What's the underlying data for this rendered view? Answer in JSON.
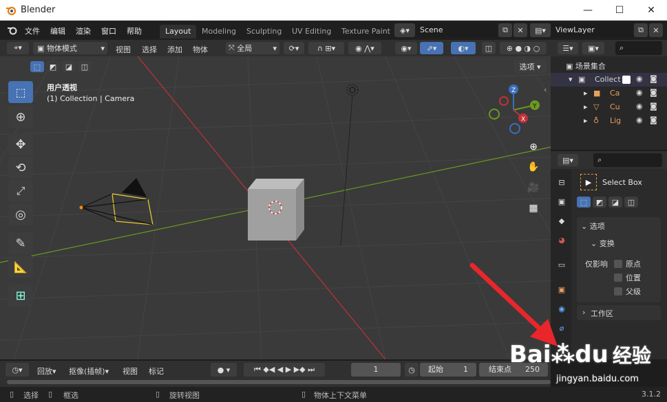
{
  "window": {
    "title": "Blender",
    "minimize": "—",
    "maximize": "☐",
    "close": "✕"
  },
  "menu": [
    "文件",
    "编辑",
    "渲染",
    "窗口",
    "帮助"
  ],
  "workspaces": [
    "Layout",
    "Modeling",
    "Sculpting",
    "UV Editing",
    "Texture Paint"
  ],
  "scene": "Scene",
  "view_layer": "ViewLayer",
  "viewport_header": {
    "mode": "物体模式",
    "menus": [
      "视图",
      "选择",
      "添加",
      "物体"
    ],
    "orientation": "全局",
    "options": "选项"
  },
  "viewport": {
    "view_name": "用户透视",
    "collection_info": "(1) Collection | Camera",
    "gizmo_axes": {
      "x": "X",
      "y": "Y",
      "z": "Z"
    }
  },
  "outliner": {
    "root": "场景集合",
    "collection": "Collect",
    "items": [
      "Ca",
      "Cu",
      "Lig"
    ]
  },
  "properties": {
    "tool_name": "Select Box",
    "options_header": "选项",
    "transform_header": "变换",
    "affect_only": "仅影响",
    "checkboxes": [
      "原点",
      "位置",
      "父级"
    ],
    "workspace_header": "工作区"
  },
  "timeline": {
    "menus": [
      "回放",
      "抠像(插帧)",
      "视图",
      "标记"
    ],
    "current_frame": "1",
    "start_label": "起始",
    "start_value": "1",
    "end_label": "结束点",
    "end_value": "250"
  },
  "status": {
    "select": "选择",
    "box": "框选",
    "rotate": "旋转视图",
    "context": "物体上下文菜单",
    "version": "3.1.2"
  },
  "watermark": {
    "brand": "Bai",
    "brand2": "du",
    "cn": "经验",
    "url": "jingyan.baidu.com"
  },
  "colors": {
    "accent": "#4772b3",
    "arrow": "#e8262b",
    "x_axis": "#c0323b",
    "y_axis": "#6a9a20",
    "camera_select": "#f0d030"
  }
}
